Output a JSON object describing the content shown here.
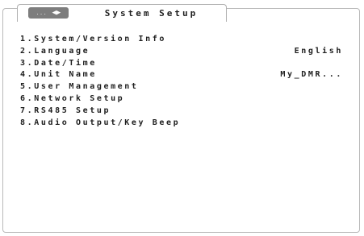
{
  "header": {
    "back_dots": "...",
    "back_arrows": "◀▶",
    "title": "System Setup"
  },
  "menu": {
    "items": [
      {
        "label": "1.System/Version Info",
        "value": ""
      },
      {
        "label": "2.Language",
        "value": "English"
      },
      {
        "label": "3.Date/Time",
        "value": ""
      },
      {
        "label": "4.Unit Name",
        "value": "My_DMR..."
      },
      {
        "label": "5.User Management",
        "value": ""
      },
      {
        "label": "6.Network Setup",
        "value": ""
      },
      {
        "label": "7.RS485 Setup",
        "value": ""
      },
      {
        "label": "8.Audio Output/Key Beep",
        "value": ""
      }
    ]
  }
}
